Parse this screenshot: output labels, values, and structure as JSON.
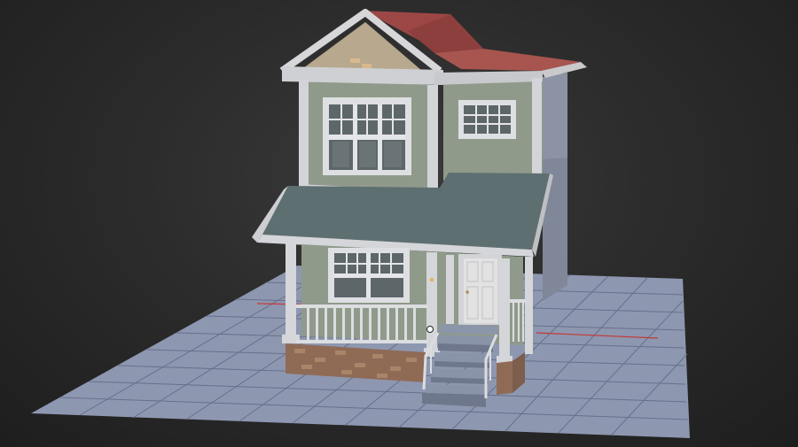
{
  "viewport": {
    "background": "#2a2a2a",
    "ground_color": "#8e97b0",
    "grid_line_color": "#5d6680",
    "x_axis_color": "#c23a3a"
  },
  "model": {
    "wall_color": "#8f9a8a",
    "trim_color": "#d7d7d9",
    "side_wall_color": "#8b93a4",
    "roof_color": "#9e4a48",
    "porch_roof_color": "#5e6f72",
    "gable_color": "#b7a88e",
    "brick_color": "#8f6b56",
    "door_color": "#e2e2e2",
    "window_glass_color": "#5d676a"
  }
}
